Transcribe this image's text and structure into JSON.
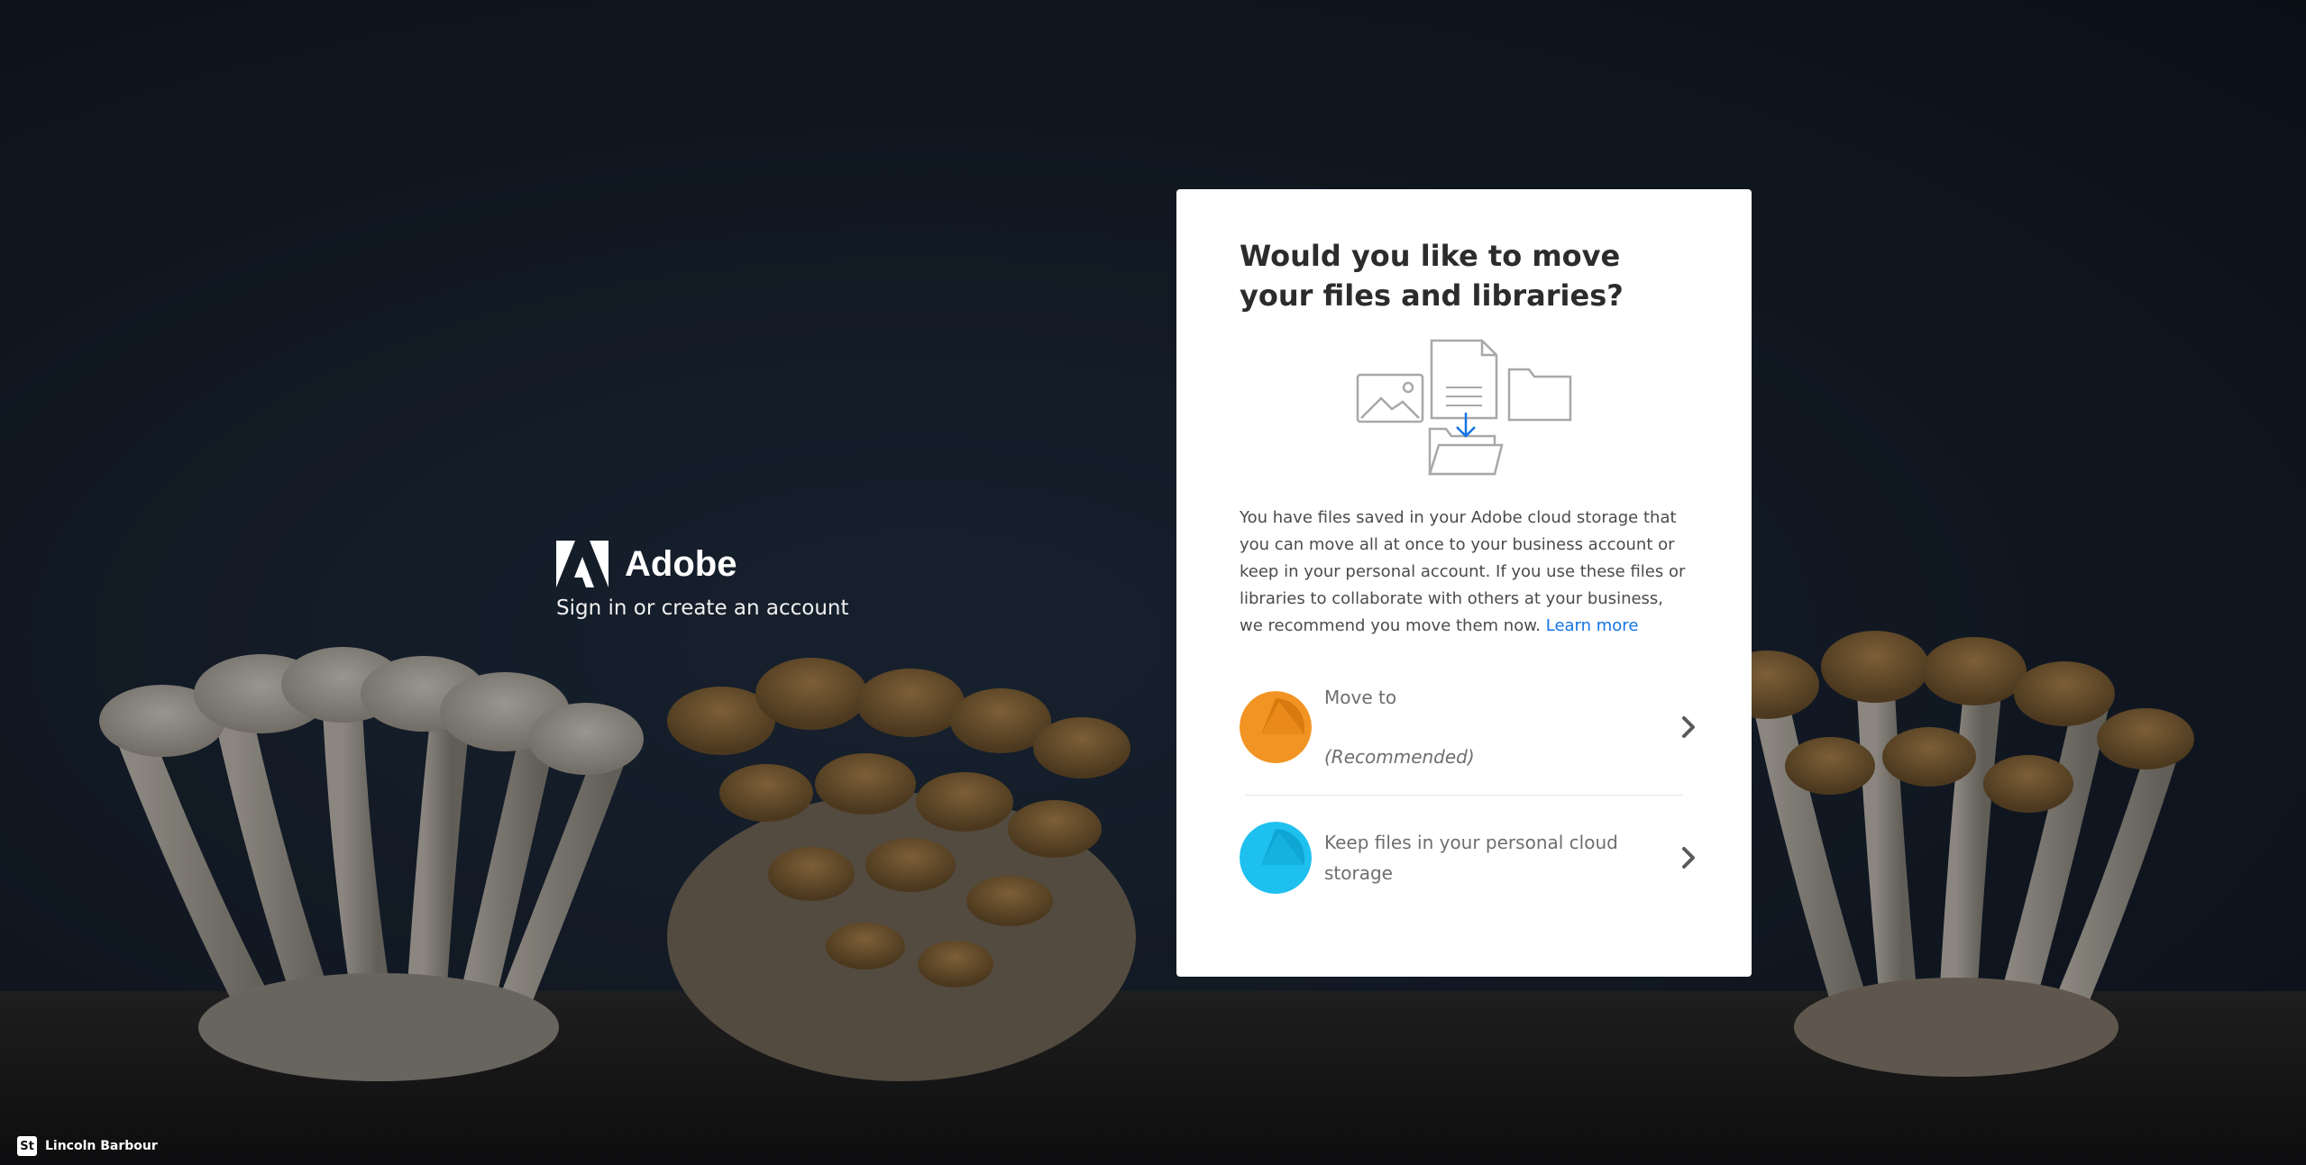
{
  "background": {
    "photo_subject": "mushrooms"
  },
  "brand": {
    "name": "Adobe",
    "tagline": "Sign in or create an account",
    "logo_icon": "adobe-logo-icon"
  },
  "dialog": {
    "title": "Would you like to move your files and libraries?",
    "illustration_icon": "files-move-illustration",
    "body": "You have files saved in your Adobe cloud storage that you can move all at once to your business account or keep in your personal account. If you use these files or libraries to collaborate with others at your business, we recommend you move them now. ",
    "learn_more": "Learn more",
    "options": [
      {
        "line1": "Move to",
        "line2": "(Recommended)",
        "color": "#f29423",
        "icon": "chevron-right-icon"
      },
      {
        "line1": "Keep files in your personal cloud storage",
        "color": "#1ec0ef",
        "icon": "chevron-right-icon"
      }
    ]
  },
  "photo_credit": {
    "badge": "St",
    "name": "Lincoln Barbour"
  },
  "colors": {
    "link": "#1473e6",
    "title": "#2c2c2c",
    "body": "#4b4b4b",
    "orange": "#f29423",
    "blue": "#1ec0ef"
  }
}
